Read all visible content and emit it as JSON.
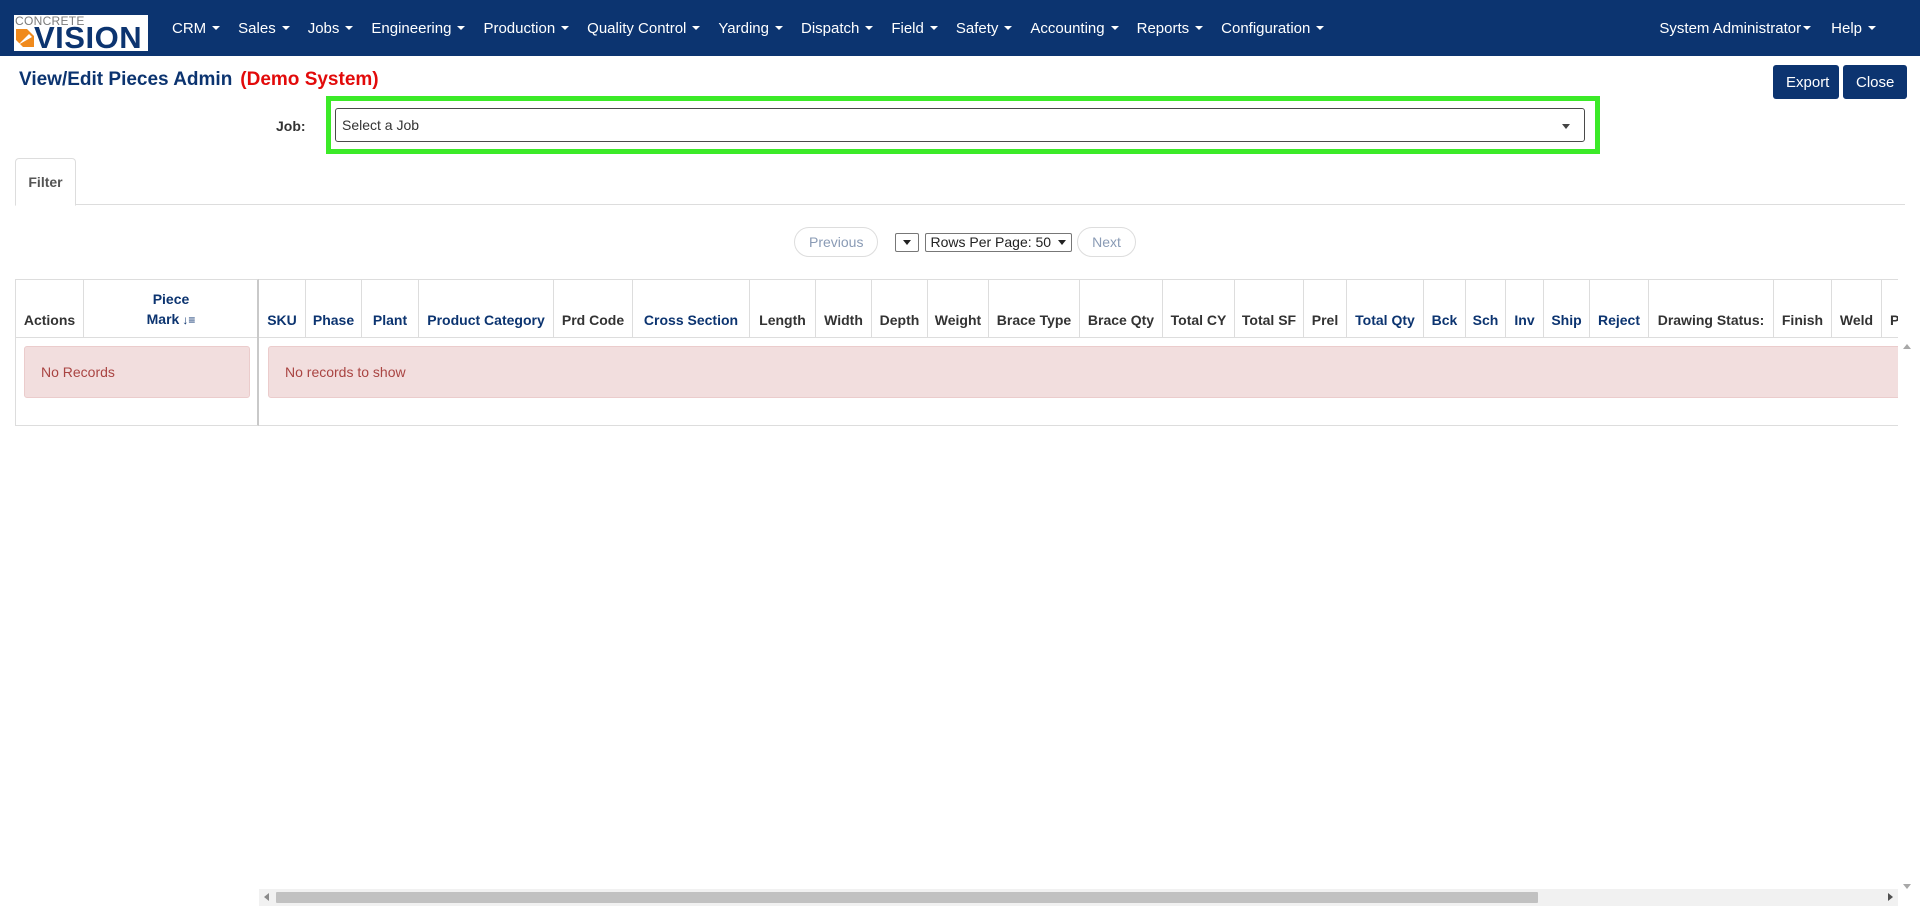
{
  "brand": {
    "logo_top": "CONCRETE",
    "logo_main": "VISION"
  },
  "nav": {
    "items": [
      {
        "label": "CRM"
      },
      {
        "label": "Sales"
      },
      {
        "label": "Jobs"
      },
      {
        "label": "Engineering"
      },
      {
        "label": "Production"
      },
      {
        "label": "Quality Control"
      },
      {
        "label": "Yarding"
      },
      {
        "label": "Dispatch"
      },
      {
        "label": "Field"
      },
      {
        "label": "Safety"
      },
      {
        "label": "Accounting"
      },
      {
        "label": "Reports"
      },
      {
        "label": "Configuration"
      }
    ],
    "user": "System Administrator",
    "help": "Help"
  },
  "header": {
    "title": "View/Edit Pieces Admin",
    "demo_tag": "(Demo System)",
    "export_label": "Export",
    "close_label": "Close"
  },
  "job": {
    "label": "Job:",
    "placeholder": "Select a Job"
  },
  "tabs": [
    {
      "label": "Filter"
    }
  ],
  "pager": {
    "previous": "Previous",
    "rows_per_page": "Rows Per Page: 50",
    "next": "Next"
  },
  "grid": {
    "left_columns": [
      "Actions",
      "Piece",
      "Mark"
    ],
    "left_empty": "No Records",
    "columns": [
      "SKU",
      "Phase",
      "Plant",
      "Product Category",
      "Prd Code",
      "Cross Section",
      "Length",
      "Width",
      "Depth",
      "Weight",
      "Brace Type",
      "Brace Qty",
      "Total CY",
      "Total SF",
      "Prel",
      "Total Qty",
      "Bck",
      "Sch",
      "Inv",
      "Ship",
      "Reject",
      "Drawing Status:",
      "Finish",
      "Weld",
      "P"
    ],
    "right_empty": "No records to show"
  },
  "colors": {
    "navbar": "#0c3470",
    "demo": "#e20a0a",
    "highlight": "#3bea28",
    "alert_bg": "#f2dede",
    "alert_text": "#a94442"
  }
}
